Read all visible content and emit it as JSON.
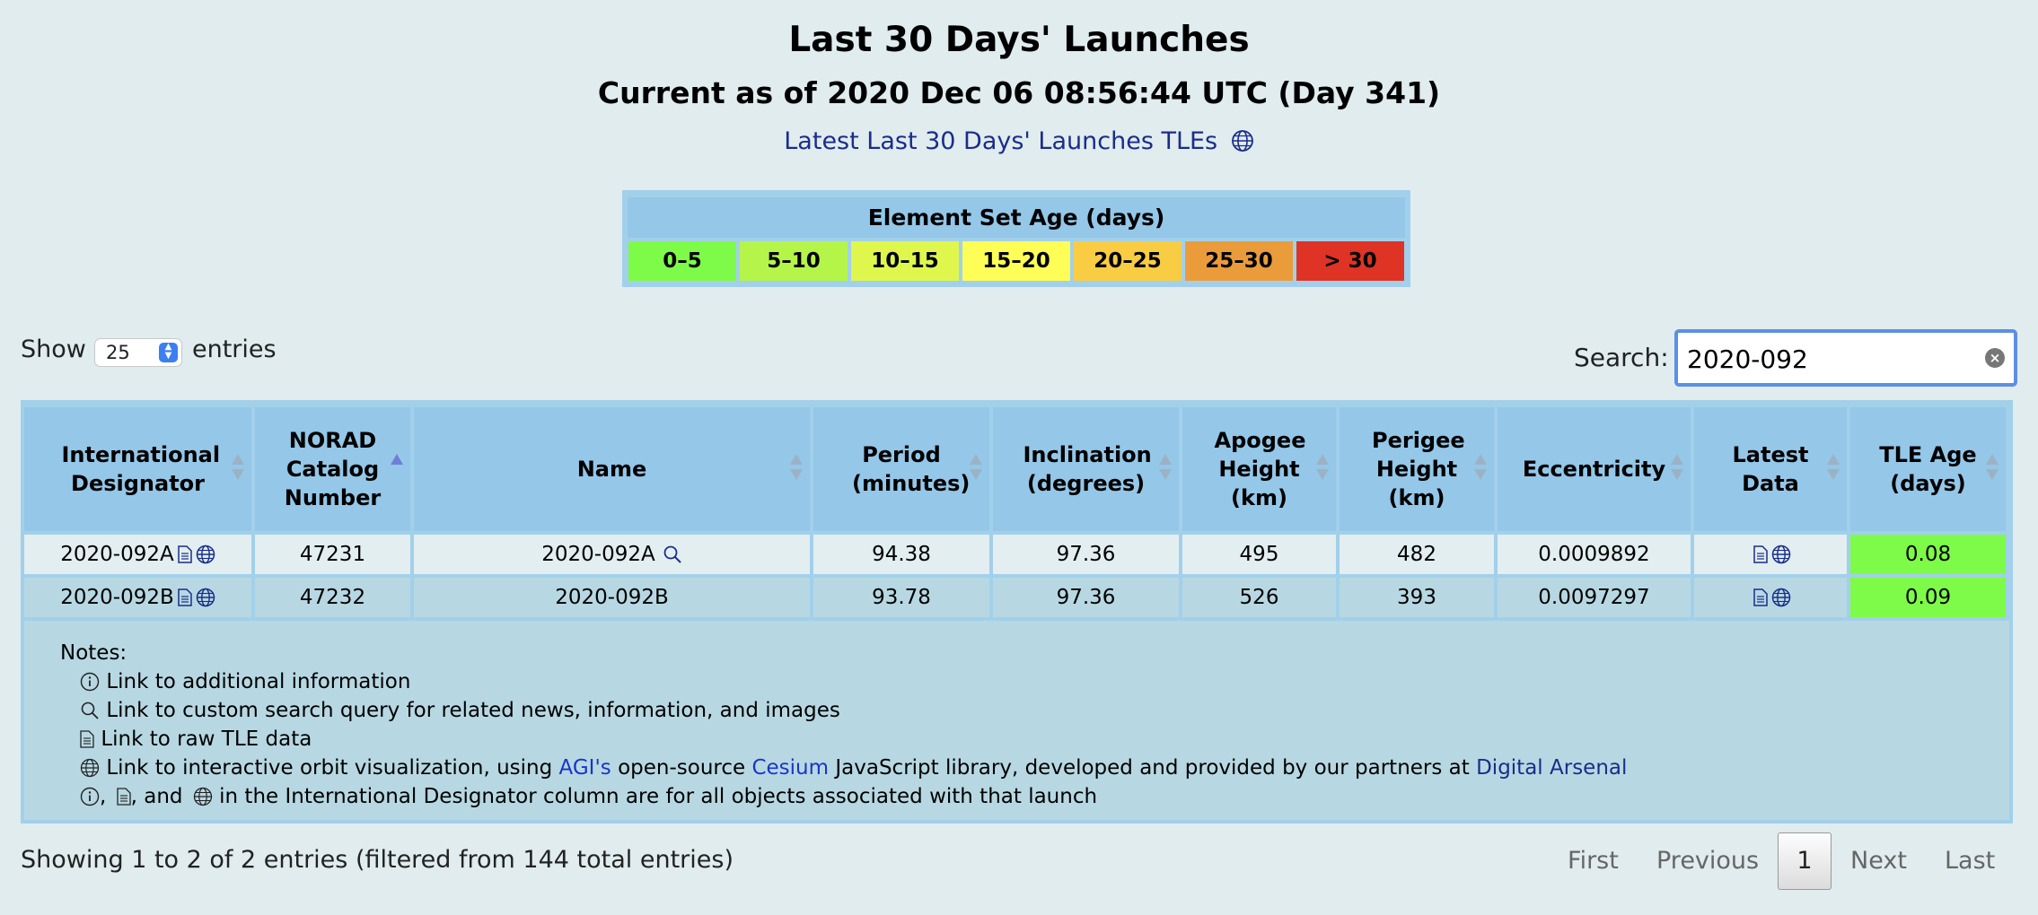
{
  "header": {
    "title": "Last 30 Days' Launches",
    "subtitle": "Current as of 2020 Dec 06 08:56:44 UTC (Day 341)",
    "tle_link": "Latest Last 30 Days' Launches TLEs"
  },
  "legend": {
    "title": "Element Set Age (days)",
    "bins": [
      {
        "label": "0–5",
        "color": "#7efb48"
      },
      {
        "label": "5–10",
        "color": "#b5f54a"
      },
      {
        "label": "10–15",
        "color": "#dff74d"
      },
      {
        "label": "15–20",
        "color": "#fefe57"
      },
      {
        "label": "20–25",
        "color": "#f8cd43"
      },
      {
        "label": "25–30",
        "color": "#eb9c3a"
      },
      {
        "label": "> 30",
        "color": "#de3325"
      }
    ]
  },
  "controls": {
    "show_label": "Show",
    "page_length": "25",
    "entries_label": "entries",
    "search_label": "Search:",
    "search_value": "2020-092"
  },
  "table": {
    "columns": [
      {
        "label": "International Designator"
      },
      {
        "label": "NORAD Catalog Number"
      },
      {
        "label": "Name"
      },
      {
        "label": "Period (minutes)"
      },
      {
        "label": "Inclination (degrees)"
      },
      {
        "label": "Apogee Height (km)"
      },
      {
        "label": "Perigee Height (km)"
      },
      {
        "label": "Eccentricity"
      },
      {
        "label": "Latest Data"
      },
      {
        "label": "TLE Age (days)"
      }
    ],
    "rows": [
      {
        "designator": "2020-092A",
        "norad": "47231",
        "name": "2020-092A",
        "period": "94.38",
        "inclination": "97.36",
        "apogee": "495",
        "perigee": "482",
        "eccentricity": "0.0009892",
        "tle_age": "0.08"
      },
      {
        "designator": "2020-092B",
        "norad": "47232",
        "name": "2020-092B",
        "period": "93.78",
        "inclination": "97.36",
        "apogee": "526",
        "perigee": "393",
        "eccentricity": "0.0097297",
        "tle_age": "0.09"
      }
    ]
  },
  "notes": {
    "heading": "Notes:",
    "info": "Link to additional information",
    "search": "Link to custom search query for related news, information, and images",
    "raw": "Link to raw TLE data",
    "orbit_pre": "Link to interactive orbit visualization, using",
    "agi": "AGI's",
    "orbit_mid": "open-source",
    "cesium": "Cesium",
    "orbit_post": "JavaScript library, developed and provided by our partners at",
    "digital_arsenal": "Digital Arsenal",
    "launch_sep1": ",",
    "launch_sep2": ", and",
    "launch_tail": "in the International Designator column are for all objects associated with that launch"
  },
  "footer": {
    "info": "Showing 1 to 2 of 2 entries (filtered from 144 total entries)",
    "first": "First",
    "previous": "Previous",
    "current": "1",
    "next": "Next",
    "last": "Last"
  }
}
